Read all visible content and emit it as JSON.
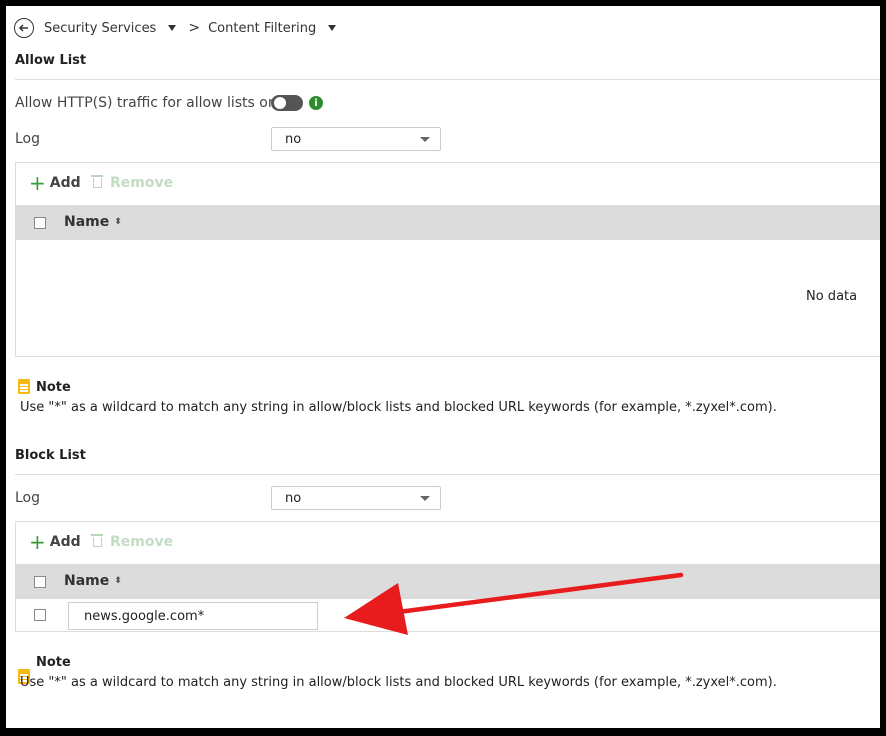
{
  "breadcrumb": {
    "back_icon": "arrow-left-circle-icon",
    "item1": "Security Services",
    "separator": ">",
    "item2": "Content Filtering"
  },
  "allow_list": {
    "title": "Allow List",
    "http_only_label": "Allow HTTP(S) traffic for allow lists only",
    "http_only_toggle": "off",
    "info_icon": "i",
    "log_label": "Log",
    "log_value": "no",
    "add_label": "Add",
    "remove_label": "Remove",
    "column_name": "Name",
    "empty_text": "No data",
    "sort_icon": "⬍"
  },
  "note1": {
    "title": "Note",
    "text": "Use \"*\" as a wildcard to match any string in allow/block lists and blocked URL keywords (for example, *.zyxel*.com)."
  },
  "block_list": {
    "title": "Block List",
    "log_label": "Log",
    "log_value": "no",
    "add_label": "Add",
    "remove_label": "Remove",
    "column_name": "Name",
    "rows": [
      {
        "name": "news.google.com*"
      }
    ]
  },
  "note2": {
    "title": "Note",
    "text": "Use \"*\" as a wildcard to match any string in allow/block lists and blocked URL keywords (for example, *.zyxel*.com)."
  },
  "colors": {
    "arrow": "#e81c1c",
    "add_green": "#3a9a3a",
    "info_green": "#2e8b2e",
    "note_yellow": "#f5b90f",
    "header_gray": "#dcdcdc"
  }
}
